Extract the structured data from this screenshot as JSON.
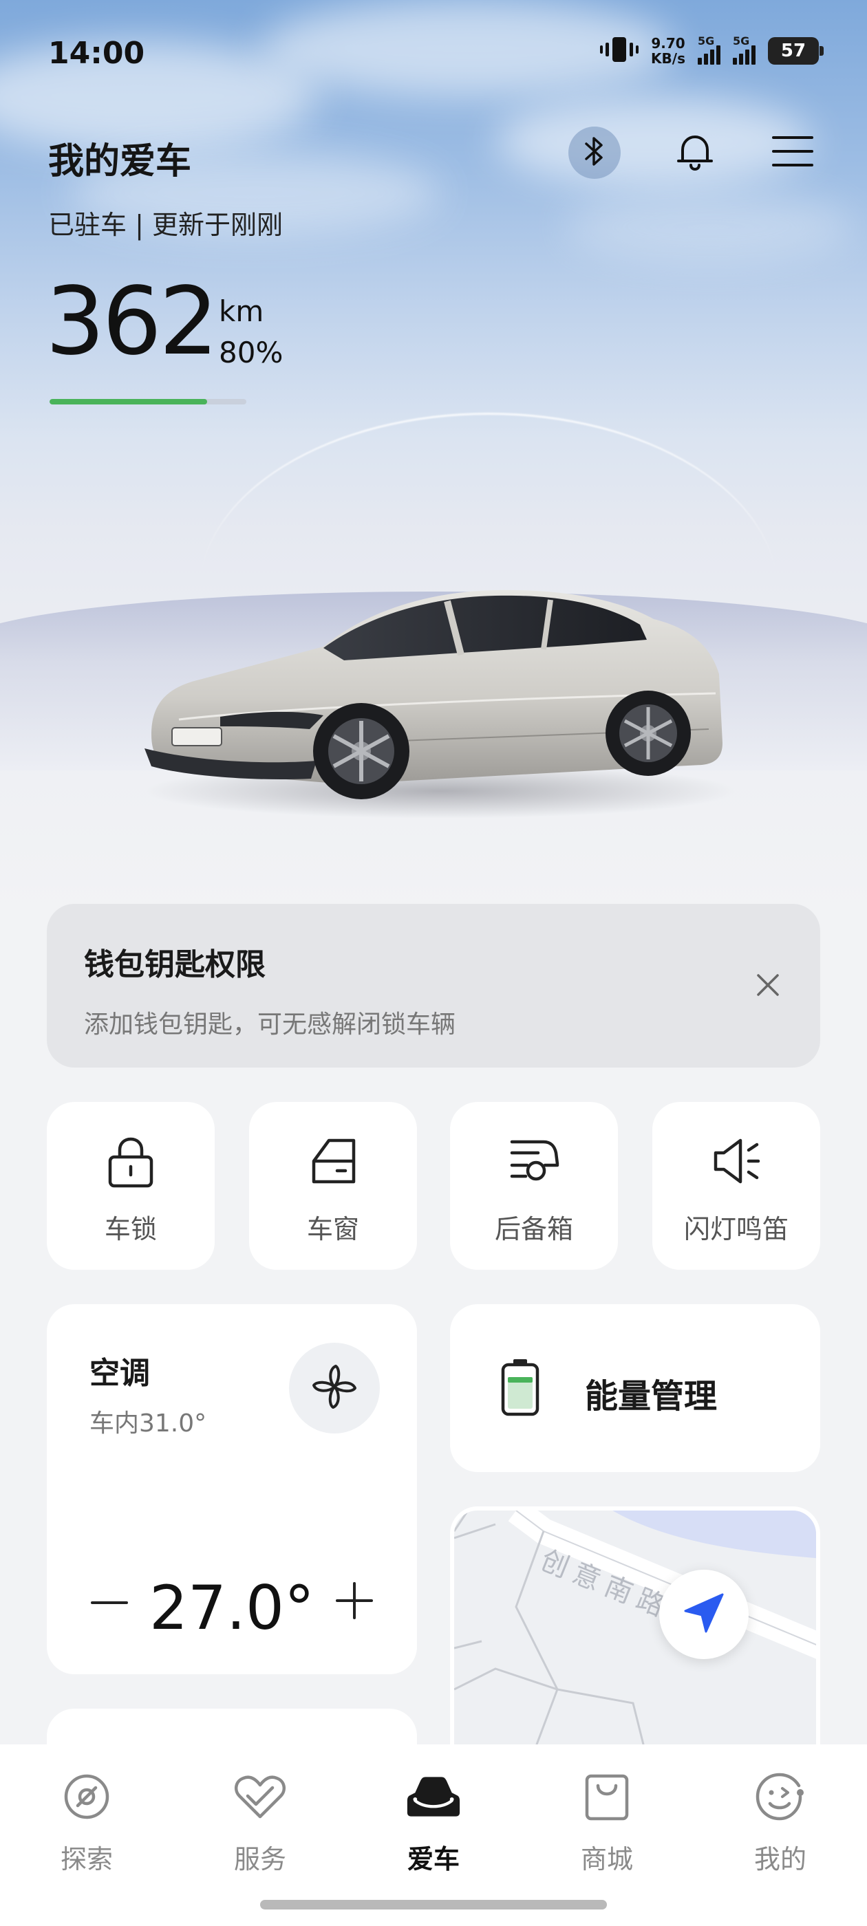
{
  "status_bar": {
    "time": "14:00",
    "net_speed_value": "9.70",
    "net_speed_unit": "KB/s",
    "signal_1_tag": "5G",
    "signal_2_tag": "5G",
    "battery": "57",
    "vibrate_icon": "vibrate-icon"
  },
  "header": {
    "title": "我的爱车",
    "status": "已驻车 | 更新于刚刚",
    "icons": [
      "bluetooth-icon",
      "bell-icon",
      "menu-icon"
    ]
  },
  "range": {
    "value": "362",
    "unit": "km",
    "percent": "80%",
    "battery_fraction": 0.8,
    "bar_color": "#49b35a"
  },
  "wallet_banner": {
    "title": "钱包钥匙权限",
    "description": "添加钱包钥匙，可无感解闭锁车辆"
  },
  "quick_controls": [
    {
      "label": "车锁",
      "icon": "lock-icon"
    },
    {
      "label": "车窗",
      "icon": "window-icon"
    },
    {
      "label": "后备箱",
      "icon": "trunk-icon"
    },
    {
      "label": "闪灯鸣笛",
      "icon": "horn-icon"
    }
  ],
  "climate": {
    "title": "空调",
    "inside_temp": "车内31.0°",
    "set_temp": "27.0°",
    "minus": "—",
    "plus": "+"
  },
  "energy": {
    "label": "能量管理"
  },
  "map": {
    "road_label": "创意南路"
  },
  "tabs": [
    {
      "label": "探索",
      "icon": "explore-icon",
      "active": false
    },
    {
      "label": "服务",
      "icon": "service-icon",
      "active": false
    },
    {
      "label": "爱车",
      "icon": "car-icon",
      "active": true
    },
    {
      "label": "商城",
      "icon": "shop-icon",
      "active": false
    },
    {
      "label": "我的",
      "icon": "profile-icon",
      "active": false
    }
  ],
  "colors": {
    "accent_green": "#49b35a",
    "nav_blue": "#2a5bf0"
  }
}
